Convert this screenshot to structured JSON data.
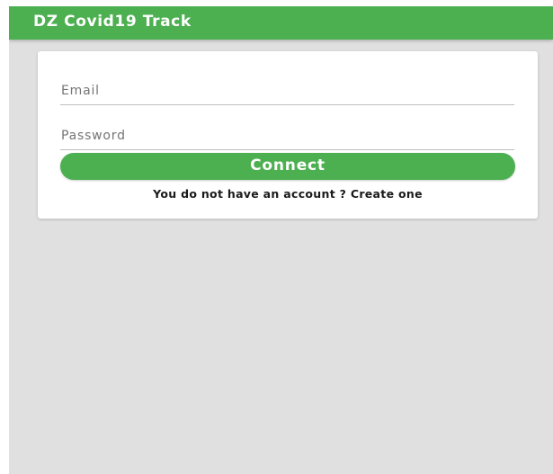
{
  "app_bar": {
    "title": "DZ Covid19 Track"
  },
  "login_form": {
    "email": {
      "placeholder": "Email",
      "value": ""
    },
    "password": {
      "placeholder": "Password",
      "value": ""
    },
    "connect_label": "Connect",
    "signup_prompt": "You do not have an account ?",
    "signup_link": "Create one"
  },
  "colors": {
    "primary": "#4caf50",
    "background": "#e0e0e0",
    "card": "#ffffff"
  }
}
